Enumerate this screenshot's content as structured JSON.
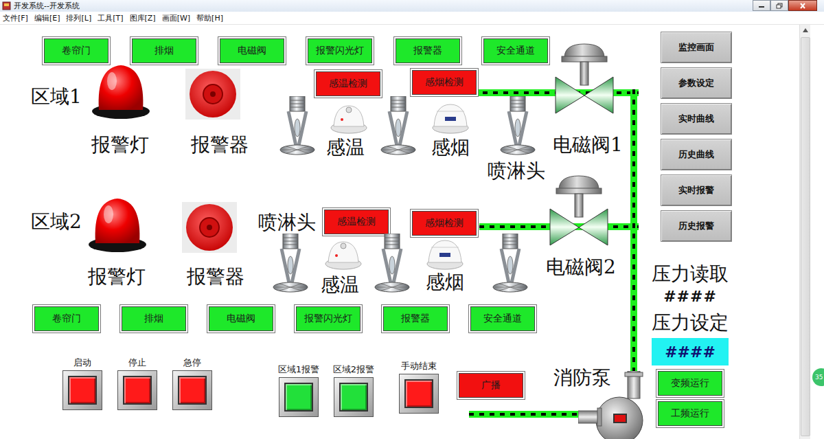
{
  "window": {
    "title": "开发系统--开发系统"
  },
  "menu": [
    "文件[F]",
    "编辑[E]",
    "排列[L]",
    "工具[T]",
    "图库[Z]",
    "画面[W]",
    "帮助[H]"
  ],
  "zones": [
    {
      "label": "区域1",
      "lamp_label": "报警灯",
      "bell_label": "报警器",
      "status": [
        {
          "label": "卷帘门",
          "active": true
        },
        {
          "label": "排烟",
          "active": true
        },
        {
          "label": "电磁阀",
          "active": true
        },
        {
          "label": "报警闪光灯",
          "active": true
        },
        {
          "label": "报警器",
          "active": true
        },
        {
          "label": "安全通道",
          "active": true
        }
      ],
      "detectors": [
        {
          "label": "感温检测",
          "alarm": true
        },
        {
          "label": "感烟检测",
          "alarm": true
        }
      ],
      "heat_label": "感温",
      "smoke_label": "感烟",
      "sprinkler_label": "喷淋头",
      "valve_label": "电磁阀1"
    },
    {
      "label": "区域2",
      "lamp_label": "报警灯",
      "bell_label": "报警器",
      "status": [
        {
          "label": "卷帘门",
          "active": true
        },
        {
          "label": "排烟",
          "active": true
        },
        {
          "label": "电磁阀",
          "active": true
        },
        {
          "label": "报警闪光灯",
          "active": true
        },
        {
          "label": "报警器",
          "active": true
        },
        {
          "label": "安全通道",
          "active": true
        }
      ],
      "detectors": [
        {
          "label": "感温检测",
          "alarm": true
        },
        {
          "label": "感烟检测",
          "alarm": true
        }
      ],
      "heat_label": "感温",
      "smoke_label": "感烟",
      "sprinkler_label": "喷淋头",
      "valve_label": "电磁阀2"
    }
  ],
  "pipe": {
    "flowing": true
  },
  "controls": [
    {
      "label": "启动",
      "color": "#ff1a1a"
    },
    {
      "label": "停止",
      "color": "#ff1a1a"
    },
    {
      "label": "急停",
      "color": "#ff1a1a"
    },
    {
      "label": "区域1报警",
      "color": "#22e03a"
    },
    {
      "label": "区域2报警",
      "color": "#22e03a"
    },
    {
      "label": "手动结束",
      "color": "#ff1a1a"
    }
  ],
  "broadcast": {
    "label": "广播",
    "active": false
  },
  "pump": {
    "label": "消防泵"
  },
  "nav": [
    "监控画面",
    "参数设定",
    "实时曲线",
    "历史曲线",
    "实时报警",
    "历史报警"
  ],
  "pressure": {
    "read_label": "压力读取",
    "read_value": "####",
    "set_label": "压力设定",
    "set_value": "####"
  },
  "run_modes": [
    {
      "label": "变频运行",
      "active": true
    },
    {
      "label": "工频运行",
      "active": true
    }
  ],
  "side_badge": "35"
}
